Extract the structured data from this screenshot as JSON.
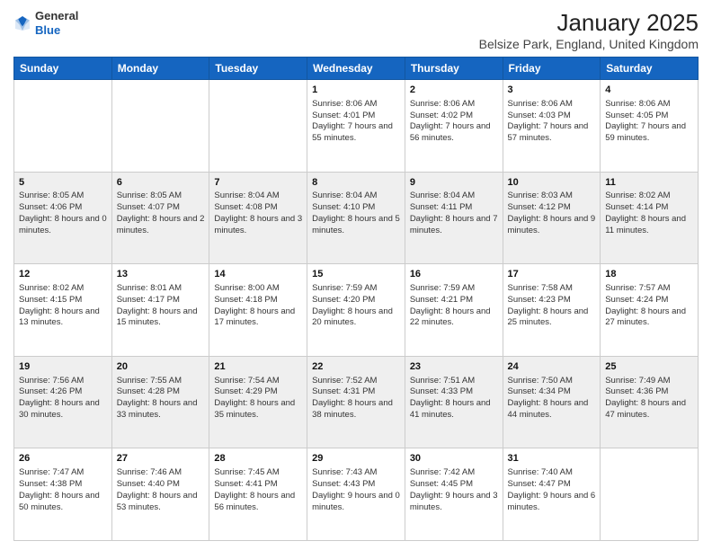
{
  "header": {
    "logo_general": "General",
    "logo_blue": "Blue",
    "title": "January 2025",
    "subtitle": "Belsize Park, England, United Kingdom"
  },
  "days_of_week": [
    "Sunday",
    "Monday",
    "Tuesday",
    "Wednesday",
    "Thursday",
    "Friday",
    "Saturday"
  ],
  "weeks": [
    {
      "shaded": false,
      "days": [
        {
          "num": "",
          "data": ""
        },
        {
          "num": "",
          "data": ""
        },
        {
          "num": "",
          "data": ""
        },
        {
          "num": "1",
          "data": "Sunrise: 8:06 AM\nSunset: 4:01 PM\nDaylight: 7 hours and 55 minutes."
        },
        {
          "num": "2",
          "data": "Sunrise: 8:06 AM\nSunset: 4:02 PM\nDaylight: 7 hours and 56 minutes."
        },
        {
          "num": "3",
          "data": "Sunrise: 8:06 AM\nSunset: 4:03 PM\nDaylight: 7 hours and 57 minutes."
        },
        {
          "num": "4",
          "data": "Sunrise: 8:06 AM\nSunset: 4:05 PM\nDaylight: 7 hours and 59 minutes."
        }
      ]
    },
    {
      "shaded": true,
      "days": [
        {
          "num": "5",
          "data": "Sunrise: 8:05 AM\nSunset: 4:06 PM\nDaylight: 8 hours and 0 minutes."
        },
        {
          "num": "6",
          "data": "Sunrise: 8:05 AM\nSunset: 4:07 PM\nDaylight: 8 hours and 2 minutes."
        },
        {
          "num": "7",
          "data": "Sunrise: 8:04 AM\nSunset: 4:08 PM\nDaylight: 8 hours and 3 minutes."
        },
        {
          "num": "8",
          "data": "Sunrise: 8:04 AM\nSunset: 4:10 PM\nDaylight: 8 hours and 5 minutes."
        },
        {
          "num": "9",
          "data": "Sunrise: 8:04 AM\nSunset: 4:11 PM\nDaylight: 8 hours and 7 minutes."
        },
        {
          "num": "10",
          "data": "Sunrise: 8:03 AM\nSunset: 4:12 PM\nDaylight: 8 hours and 9 minutes."
        },
        {
          "num": "11",
          "data": "Sunrise: 8:02 AM\nSunset: 4:14 PM\nDaylight: 8 hours and 11 minutes."
        }
      ]
    },
    {
      "shaded": false,
      "days": [
        {
          "num": "12",
          "data": "Sunrise: 8:02 AM\nSunset: 4:15 PM\nDaylight: 8 hours and 13 minutes."
        },
        {
          "num": "13",
          "data": "Sunrise: 8:01 AM\nSunset: 4:17 PM\nDaylight: 8 hours and 15 minutes."
        },
        {
          "num": "14",
          "data": "Sunrise: 8:00 AM\nSunset: 4:18 PM\nDaylight: 8 hours and 17 minutes."
        },
        {
          "num": "15",
          "data": "Sunrise: 7:59 AM\nSunset: 4:20 PM\nDaylight: 8 hours and 20 minutes."
        },
        {
          "num": "16",
          "data": "Sunrise: 7:59 AM\nSunset: 4:21 PM\nDaylight: 8 hours and 22 minutes."
        },
        {
          "num": "17",
          "data": "Sunrise: 7:58 AM\nSunset: 4:23 PM\nDaylight: 8 hours and 25 minutes."
        },
        {
          "num": "18",
          "data": "Sunrise: 7:57 AM\nSunset: 4:24 PM\nDaylight: 8 hours and 27 minutes."
        }
      ]
    },
    {
      "shaded": true,
      "days": [
        {
          "num": "19",
          "data": "Sunrise: 7:56 AM\nSunset: 4:26 PM\nDaylight: 8 hours and 30 minutes."
        },
        {
          "num": "20",
          "data": "Sunrise: 7:55 AM\nSunset: 4:28 PM\nDaylight: 8 hours and 33 minutes."
        },
        {
          "num": "21",
          "data": "Sunrise: 7:54 AM\nSunset: 4:29 PM\nDaylight: 8 hours and 35 minutes."
        },
        {
          "num": "22",
          "data": "Sunrise: 7:52 AM\nSunset: 4:31 PM\nDaylight: 8 hours and 38 minutes."
        },
        {
          "num": "23",
          "data": "Sunrise: 7:51 AM\nSunset: 4:33 PM\nDaylight: 8 hours and 41 minutes."
        },
        {
          "num": "24",
          "data": "Sunrise: 7:50 AM\nSunset: 4:34 PM\nDaylight: 8 hours and 44 minutes."
        },
        {
          "num": "25",
          "data": "Sunrise: 7:49 AM\nSunset: 4:36 PM\nDaylight: 8 hours and 47 minutes."
        }
      ]
    },
    {
      "shaded": false,
      "days": [
        {
          "num": "26",
          "data": "Sunrise: 7:47 AM\nSunset: 4:38 PM\nDaylight: 8 hours and 50 minutes."
        },
        {
          "num": "27",
          "data": "Sunrise: 7:46 AM\nSunset: 4:40 PM\nDaylight: 8 hours and 53 minutes."
        },
        {
          "num": "28",
          "data": "Sunrise: 7:45 AM\nSunset: 4:41 PM\nDaylight: 8 hours and 56 minutes."
        },
        {
          "num": "29",
          "data": "Sunrise: 7:43 AM\nSunset: 4:43 PM\nDaylight: 9 hours and 0 minutes."
        },
        {
          "num": "30",
          "data": "Sunrise: 7:42 AM\nSunset: 4:45 PM\nDaylight: 9 hours and 3 minutes."
        },
        {
          "num": "31",
          "data": "Sunrise: 7:40 AM\nSunset: 4:47 PM\nDaylight: 9 hours and 6 minutes."
        },
        {
          "num": "",
          "data": ""
        }
      ]
    }
  ]
}
